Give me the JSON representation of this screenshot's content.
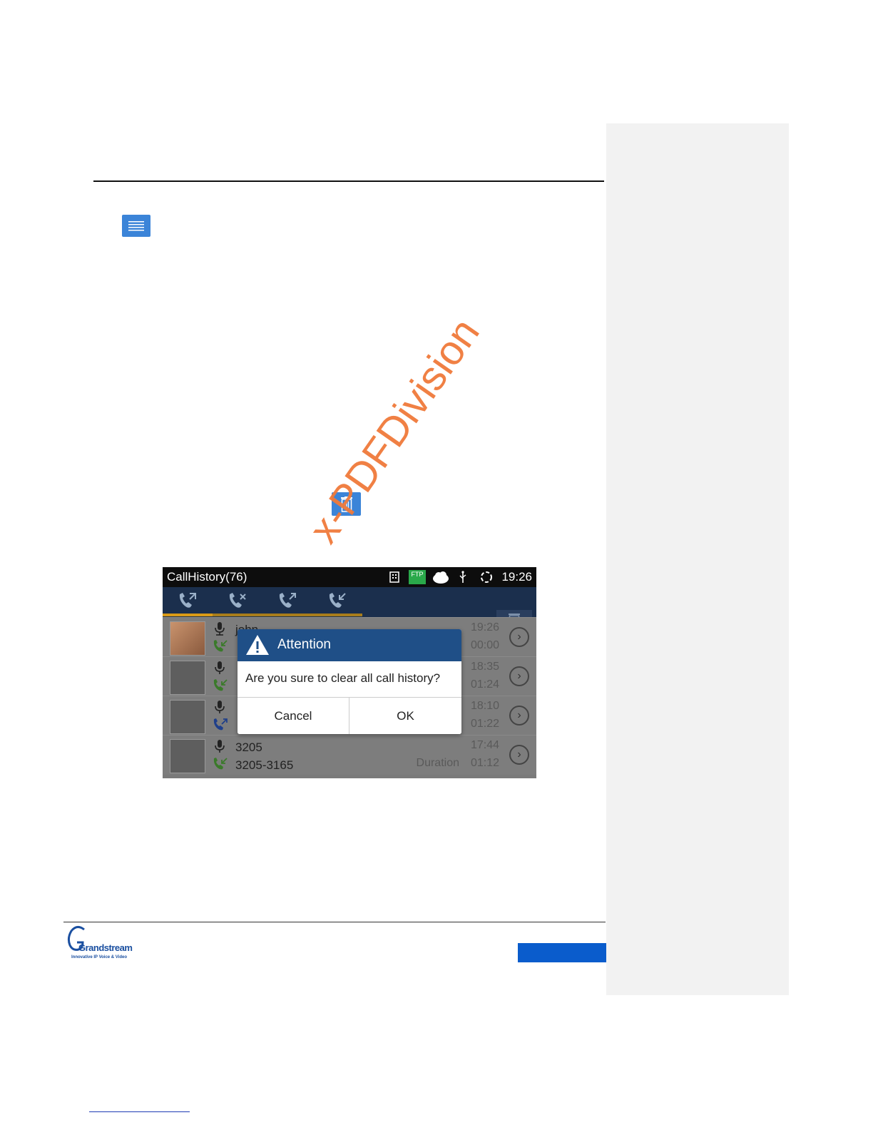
{
  "screenshot": {
    "status_title": "CallHistory(76)",
    "status_time": "19:26",
    "status_ftp": "FTP",
    "rows": [
      {
        "name": "john",
        "number": "",
        "time": "19:26",
        "duration": "00:00",
        "duration_label": ""
      },
      {
        "name": "",
        "number": "",
        "time": "18:35",
        "duration": "01:24",
        "duration_label": ""
      },
      {
        "name": "",
        "number": "",
        "time": "18:10",
        "duration": "01:22",
        "duration_label": ""
      },
      {
        "name": "3205",
        "number": "3205-3165",
        "time": "17:44",
        "duration": "01:12",
        "duration_label": "Duration"
      }
    ],
    "dialog": {
      "title": "Attention",
      "message": "Are you sure to clear all call history?",
      "cancel": "Cancel",
      "ok": "OK"
    }
  },
  "logo": {
    "name": "Grandstream",
    "tagline": "Innovative IP Voice & Video"
  },
  "watermark": "x-PDFDivision",
  "icons": [
    "menu-icon",
    "trash-icon",
    "missed-call-icon",
    "outgoing-call-icon",
    "incoming-call-icon",
    "all-calls-icon",
    "microphone-icon",
    "chevron-right-icon",
    "warning-icon"
  ],
  "colors": {
    "accent": "#3b84d8",
    "footer_bar": "#0a5ccc",
    "dialog_header": "#1f4f87"
  }
}
